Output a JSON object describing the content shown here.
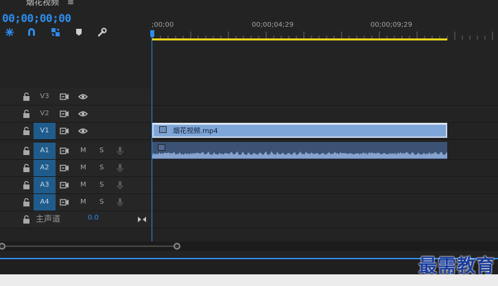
{
  "sequence": {
    "title": "烟花视频",
    "menu_icon": "hamburger-icon"
  },
  "timecode": "00;00;00;00",
  "toolbar": [
    "snap-icon",
    "magnet-icon",
    "linked-selection-icon",
    "marker-icon",
    "wrench-icon"
  ],
  "ruler": {
    "ticks": [
      ";00;00",
      "00;00;04;29",
      "00;00;09;29"
    ]
  },
  "tracks": {
    "v3": {
      "name": "V3"
    },
    "v2": {
      "name": "V2"
    },
    "v1": {
      "name": "V1"
    },
    "a1": {
      "name": "A1",
      "m": "M",
      "s": "S"
    },
    "a2": {
      "name": "A2",
      "m": "M",
      "s": "S"
    },
    "a3": {
      "name": "A3",
      "m": "M",
      "s": "S"
    },
    "a4": {
      "name": "A4",
      "m": "M",
      "s": "S"
    }
  },
  "master": {
    "label": "主声道",
    "value": "0.0"
  },
  "clips": {
    "video": "烟花视频.mp4"
  },
  "watermark": "最需教育",
  "colors": {
    "accent": "#2d8ceb",
    "workarea": "#e8d31b",
    "video_clip": "#7fa6d8",
    "audio_clip": "#3c5274",
    "target_track": "#1f5c8c"
  }
}
